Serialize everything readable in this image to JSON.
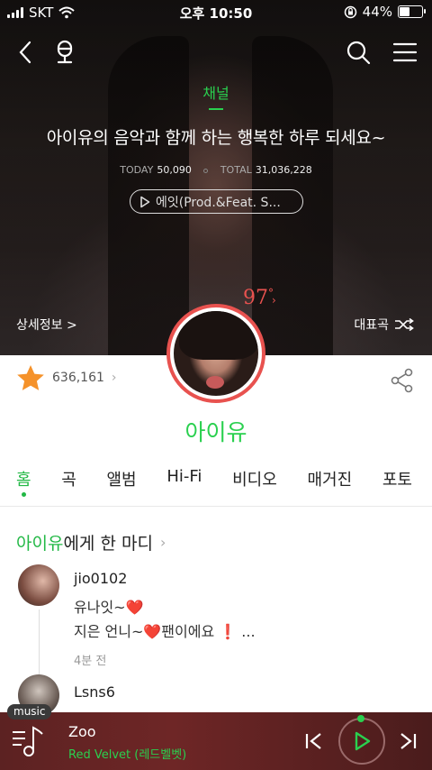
{
  "status": {
    "carrier": "SKT",
    "time": "오후 10:50",
    "battery": "44%",
    "battery_level": 0.44
  },
  "hero": {
    "channel_label": "채널",
    "headline": "아이유의 음악과 함께 하는 행복한 하루 되세요~",
    "today_label": "TODAY",
    "today_value": "50,090",
    "total_label": "TOTAL",
    "total_value": "31,036,228",
    "song": "에잇(Prod.&Feat. S...",
    "detail_link": "상세정보 >",
    "rep_songs": "대표곡",
    "percent": "97",
    "percent_unit": "°"
  },
  "profile": {
    "likes": "636,161",
    "name": "아이유"
  },
  "tabs": [
    {
      "label": "홈",
      "active": true
    },
    {
      "label": "곡"
    },
    {
      "label": "앨범"
    },
    {
      "label": "Hi-Fi"
    },
    {
      "label": "비디오"
    },
    {
      "label": "매거진"
    },
    {
      "label": "포토"
    }
  ],
  "comments": {
    "title_artist": "아이유",
    "title_rest": "에게 한 마디",
    "items": [
      {
        "user": "jio0102",
        "line1": "유나잇~",
        "line2_pre": "지은 언니~",
        "line2_post": "팬이에요",
        "time": "4분 전"
      },
      {
        "user": "Lsns6"
      }
    ]
  },
  "player": {
    "tag": "music",
    "title": "Zoo",
    "artist": "Red Velvet (레드벨벳)"
  },
  "colors": {
    "accent": "#22b845",
    "highlight": "#e8524f",
    "player_bg": "#5c2222"
  }
}
